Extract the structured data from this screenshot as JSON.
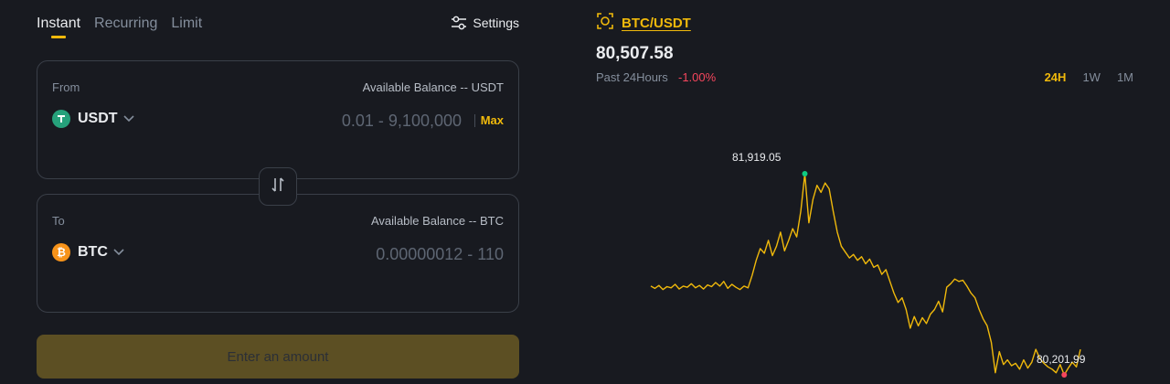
{
  "tabs": [
    {
      "label": "Instant"
    },
    {
      "label": "Recurring"
    },
    {
      "label": "Limit"
    }
  ],
  "settings": {
    "label": "Settings",
    "icon": "sliders-icon"
  },
  "from": {
    "label": "From",
    "balance": "Available Balance -- USDT",
    "asset": "USDT",
    "range_placeholder": "0.01 - 9,100,000",
    "max_label": "Max"
  },
  "to": {
    "label": "To",
    "balance": "Available Balance -- BTC",
    "asset": "BTC",
    "range_placeholder": "0.00000012 - 110"
  },
  "swap": {
    "icon": "swap-arrows-icon"
  },
  "submit": {
    "label": "Enter an amount"
  },
  "market": {
    "pair": "BTC/USDT",
    "price": "80,507.58",
    "period_label": "Past 24Hours",
    "change": "-1.00%",
    "ranges": [
      "24H",
      "1W",
      "1M"
    ],
    "active_range": "24H"
  },
  "chart_data": {
    "type": "line",
    "high_label": "81,919.05",
    "low_label": "80,201.99",
    "high": 81919.05,
    "low": 80201.99,
    "values": [
      80960,
      80940,
      80965,
      80930,
      80955,
      80945,
      80975,
      80935,
      80960,
      80950,
      80980,
      80945,
      80965,
      80935,
      80970,
      80955,
      80990,
      80960,
      81000,
      80940,
      80975,
      80950,
      80930,
      80960,
      80945,
      81050,
      81180,
      81280,
      81240,
      81350,
      81220,
      81300,
      81420,
      81260,
      81350,
      81450,
      81380,
      81600,
      81919.05,
      81500,
      81700,
      81820,
      81760,
      81840,
      81790,
      81600,
      81420,
      81300,
      81250,
      81200,
      81230,
      81180,
      81210,
      81150,
      81190,
      81120,
      81140,
      81060,
      81100,
      81000,
      80900,
      80820,
      80860,
      80760,
      80600,
      80700,
      80620,
      80690,
      80640,
      80720,
      80760,
      80830,
      80740,
      80950,
      80980,
      81020,
      81000,
      81010,
      80960,
      80900,
      80860,
      80760,
      80680,
      80620,
      80480,
      80220,
      80400,
      80290,
      80330,
      80280,
      80300,
      80250,
      80330,
      80260,
      80310,
      80420,
      80340,
      80300,
      80270,
      80250,
      80220,
      80290,
      80201.99,
      80260,
      80310,
      80270,
      80420
    ]
  }
}
